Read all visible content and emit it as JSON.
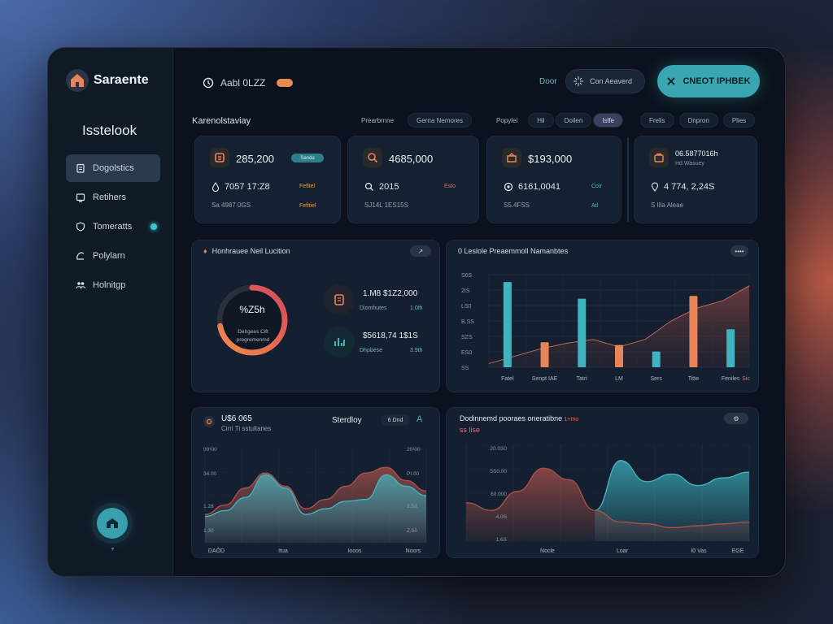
{
  "app": {
    "name": "Saraente"
  },
  "sidebar": {
    "title": "Isstelook",
    "items": [
      {
        "label": "Dogolstics",
        "icon": "clipboard-icon"
      },
      {
        "label": "Retihers",
        "icon": "monitor-icon"
      },
      {
        "label": "Tomeratts",
        "icon": "shield-icon"
      },
      {
        "label": "Polylarn",
        "icon": "curve-icon"
      },
      {
        "label": "Holnitgp",
        "icon": "people-icon"
      }
    ]
  },
  "topbar": {
    "clock": "Aabl 0LZZ",
    "label": "Door",
    "search": "Con Aeaverd",
    "cta": "CNEOT IPHBEK"
  },
  "overview": {
    "title": "Karenolstaviay",
    "filters_a": [
      "Prearbrnne",
      "Gerna Nemores"
    ],
    "filters_b": [
      "Popylei",
      "Hil",
      "Doilen",
      "Islfe"
    ],
    "filters_c": [
      "Frelis",
      "Dnpron",
      "Plies"
    ]
  },
  "stats": [
    {
      "value": "285,200",
      "badge": "Sanda",
      "row": "7057 17:Z8",
      "row_tag": "Fefitel",
      "sub": "Sa 4987 0GS",
      "sub_tag": "Fefitiel"
    },
    {
      "value": "4685,000",
      "row": "2015",
      "row_tag": "Esto",
      "sub": "SJ14L 1ES15S"
    },
    {
      "value": "$193,000",
      "row": "6161,0041",
      "row_tag": "Coir",
      "sub": "S5.4FSS",
      "sub_tag": "Atl"
    },
    {
      "value": "06.5877016h",
      "value_sub": "Hd Wasuey",
      "row": "4 774, 2,24S",
      "sub": "S Illa Aleae"
    }
  ],
  "gauge_panel": {
    "title": "Honhrauee Neil Lucition",
    "gauge_value": "%Z5h",
    "gauge_caption": "Delrgees Cift pregremenmd",
    "gauge_fill": 0.72,
    "items": [
      {
        "value": "1.M8 $1Z2,000",
        "label": "Diomhutes",
        "tag": "1.0th"
      },
      {
        "value": "$5618,74 1$1S",
        "label": "Dhpbese",
        "tag": "3.9th"
      }
    ]
  },
  "bar_panel": {
    "title": "0 Leslole Preaemmoll Namanbtes",
    "button": "••••"
  },
  "line_panel_left": {
    "value": "U$6 065",
    "sub": "Cirri Ti sstultanes",
    "label": "Sterdloy",
    "chip": "6 Dnd",
    "letter": "A",
    "button": "—"
  },
  "line_panel_right": {
    "title": "Dodinnemd pooraes oneratibne",
    "title_tag": "1+Ino",
    "sub": "ss lise",
    "button": "⚙"
  },
  "colors": {
    "teal": "#3fb3c0",
    "orange": "#e8845a",
    "bg": "#0b121d"
  },
  "chart_data": [
    {
      "type": "bar",
      "title": "0 Leslole Preaemmoll Namanbtes",
      "categories": [
        "Fatel",
        "Senpt IAE",
        "Tatri",
        "LM",
        "Sers",
        "Titte",
        "Feniles"
      ],
      "extra_x_label": "Sic",
      "y_ticks": [
        "S6S",
        "2IS",
        "LS0",
        "B.SS",
        "SZS",
        "ES0",
        "SS"
      ],
      "series": [
        {
          "color": "#3fb3c0",
          "values": [
            92,
            0,
            74,
            0,
            17,
            0,
            41
          ]
        },
        {
          "color": "#e8845a",
          "values": [
            0,
            27,
            0,
            24,
            0,
            77,
            0
          ]
        }
      ],
      "area": [
        4,
        12,
        20,
        26,
        30,
        22,
        30,
        50,
        64,
        72,
        88
      ],
      "ylim": [
        0,
        100
      ]
    },
    {
      "type": "area",
      "x_labels": [
        "DAÔD",
        "Itua",
        "Iooos",
        "Noors"
      ],
      "y_ticks_left": [
        "00¹00",
        "34.00",
        "1.28",
        "1.30"
      ],
      "y_ticks_right": [
        "20¹00",
        "PI.00",
        "3.S8",
        "Z,50"
      ],
      "series": [
        {
          "color": "#3fb3c0",
          "values": [
            28,
            34,
            48,
            72,
            58,
            30,
            36,
            44,
            46,
            72,
            60,
            50
          ]
        },
        {
          "color": "#a85048",
          "values": [
            30,
            40,
            58,
            74,
            60,
            36,
            46,
            60,
            74,
            80,
            66,
            55
          ]
        }
      ],
      "ylim": [
        0,
        100
      ]
    },
    {
      "type": "area",
      "x_labels": [
        "Nocle",
        "Loar",
        "I0 Vas",
        "EGE"
      ],
      "y_ticks": [
        "20.0S0",
        "5S0.00",
        "60.000",
        "4.0S",
        "1.6S"
      ],
      "series": [
        {
          "color": "#a85048",
          "values": [
            40,
            32,
            52,
            76,
            64,
            32,
            20,
            18,
            14,
            16,
            18,
            20
          ]
        },
        {
          "color": "#3fb3c0",
          "values": [
            0,
            0,
            0,
            0,
            0,
            32,
            84,
            62,
            70,
            58,
            66,
            72
          ]
        }
      ],
      "ylim": [
        0,
        100
      ]
    }
  ]
}
